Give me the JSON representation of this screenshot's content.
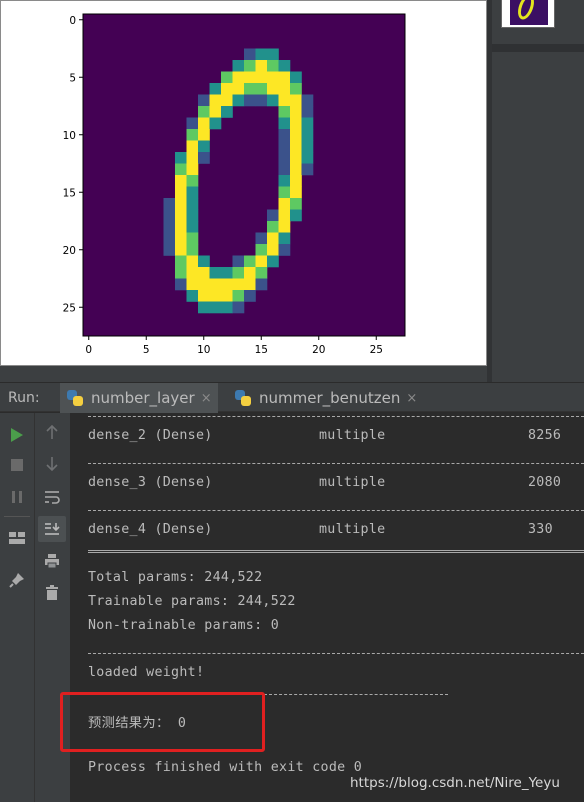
{
  "plot": {
    "x_ticks": [
      "0",
      "5",
      "10",
      "15",
      "20",
      "25"
    ],
    "y_ticks": [
      "0",
      "5",
      "10",
      "15",
      "20",
      "25"
    ],
    "colormap": {
      "background": "#440154",
      "low": "#3b528b",
      "mid": "#21918c",
      "high": "#5ec962",
      "max": "#fde725"
    }
  },
  "run_panel": {
    "label": "Run:",
    "tabs": [
      {
        "name": "number_layer",
        "close": "×"
      },
      {
        "name": "nummer_benutzen",
        "close": "×"
      }
    ]
  },
  "console": {
    "rows": [
      {
        "layer": "dense_2 (Dense)",
        "shape": "multiple",
        "params": "8256"
      },
      {
        "layer": "dense_3 (Dense)",
        "shape": "multiple",
        "params": "2080"
      },
      {
        "layer": "dense_4 (Dense)",
        "shape": "multiple",
        "params": "330"
      }
    ],
    "total_params": "Total params: 244,522",
    "trainable_params": "Trainable params: 244,522",
    "non_trainable_params": "Non-trainable params: 0",
    "loaded": "loaded weight!",
    "prediction_label": "预测结果为：",
    "prediction_value": "0",
    "exit": "Process finished with exit code 0"
  },
  "watermark": "https://blog.csdn.net/Nire_Yeyu"
}
